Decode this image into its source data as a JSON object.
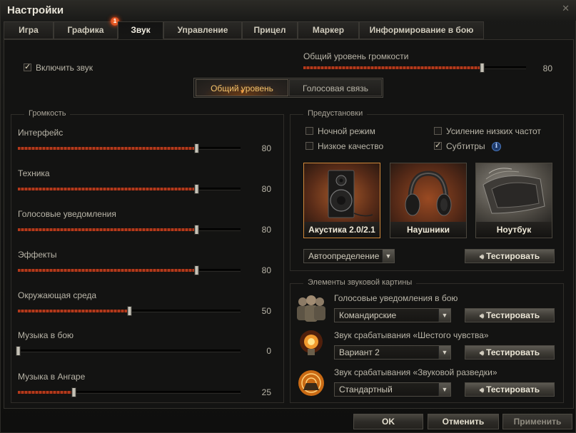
{
  "window": {
    "title": "Настройки"
  },
  "tabs": [
    {
      "label": "Игра"
    },
    {
      "label": "Графика",
      "badge": "1"
    },
    {
      "label": "Звук"
    },
    {
      "label": "Управление"
    },
    {
      "label": "Прицел"
    },
    {
      "label": "Маркер"
    },
    {
      "label": "Информирование в бою"
    }
  ],
  "sound": {
    "enable_label": "Включить звук",
    "enabled": true,
    "master": {
      "label": "Общий уровень громкости",
      "value": 80
    }
  },
  "segment": {
    "options": [
      "Общий уровень",
      "Голосовая связь"
    ],
    "selected": 0
  },
  "volume": {
    "title": "Громкость",
    "items": [
      {
        "label": "Интерфейс",
        "value": 80
      },
      {
        "label": "Техника",
        "value": 80
      },
      {
        "label": "Голосовые уведомления",
        "value": 80
      },
      {
        "label": "Эффекты",
        "value": 80
      },
      {
        "label": "Окружающая среда",
        "value": 50
      },
      {
        "label": "Музыка в бою",
        "value": 0
      },
      {
        "label": "Музыка в Ангаре",
        "value": 25
      }
    ]
  },
  "presets": {
    "title": "Предустановки",
    "checks": [
      {
        "label": "Ночной режим",
        "checked": false
      },
      {
        "label": "Усиление низких частот",
        "checked": false
      },
      {
        "label": "Низкое качество",
        "checked": false
      },
      {
        "label": "Субтитры",
        "checked": true
      }
    ],
    "info_icon": "i",
    "devices": [
      {
        "label": "Акустика 2.0/2.1",
        "icon": "speaker-icon",
        "selected": true
      },
      {
        "label": "Наушники",
        "icon": "headphones-icon",
        "selected": false
      },
      {
        "label": "Ноутбук",
        "icon": "laptop-icon",
        "selected": false
      }
    ],
    "auto_dropdown": "Автоопределение",
    "test_label": "Тестировать"
  },
  "elements": {
    "title": "Элементы звуковой картины",
    "items": [
      {
        "title": "Голосовые уведомления в бою",
        "value": "Командирские",
        "icon": "crew-icon"
      },
      {
        "title": "Звук срабатывания «Шестого чувства»",
        "value": "Вариант 2",
        "icon": "lightbulb-icon"
      },
      {
        "title": "Звук срабатывания «Звуковой разведки»",
        "value": "Стандартный",
        "icon": "radar-icon"
      }
    ],
    "test_label": "Тестировать"
  },
  "footer": {
    "ok": "OK",
    "cancel": "Отменить",
    "apply": "Применить"
  },
  "colors": {
    "accent": "#f4c26a",
    "fill": "#b43a1c",
    "active_border": "#d0883a"
  }
}
